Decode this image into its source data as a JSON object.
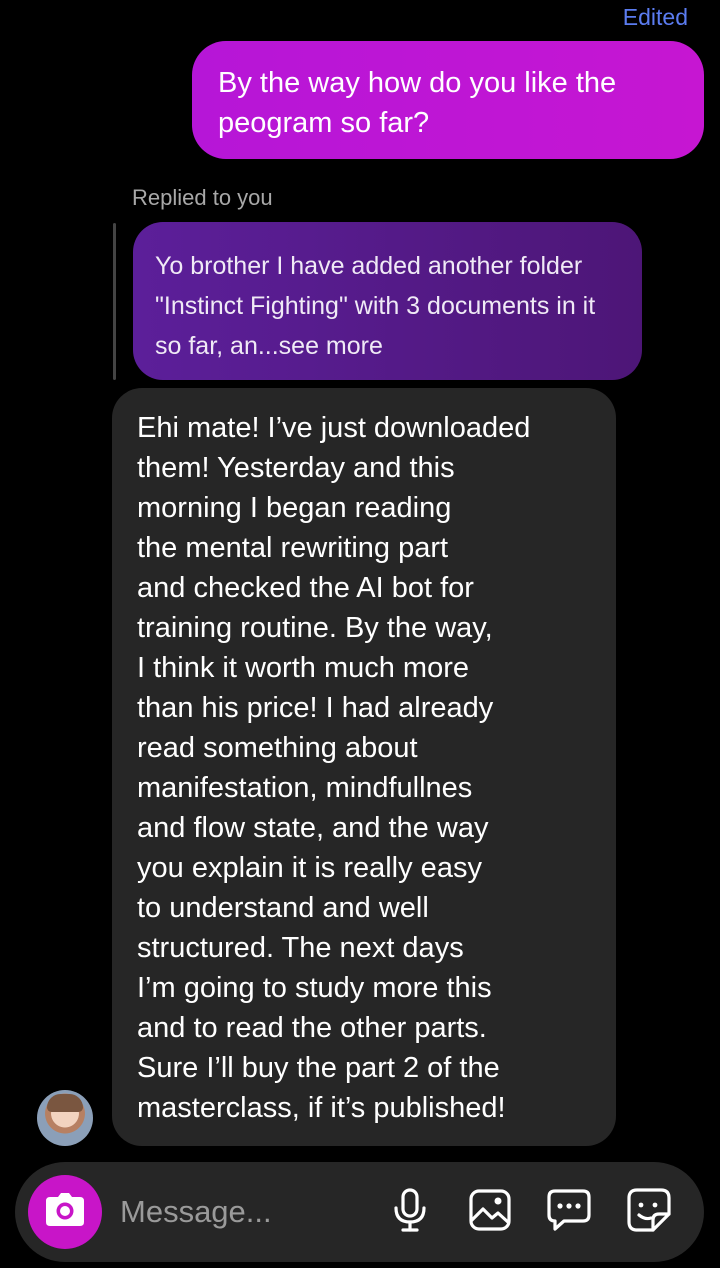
{
  "thread": {
    "edited_label": "Edited",
    "sent_message": "By the way how do you like the peogram so far?",
    "replied_label": "Replied to you",
    "quoted_message": "Yo brother I have added another folder \"Instinct Fighting\" with 3 documents in it so far, an...see more",
    "received_message": "Ehi mate! I’ve just downloaded\nthem! Yesterday and this\nmorning I began reading\nthe mental rewriting part\nand checked the AI bot for\ntraining routine. By the way,\nI think it worth much more\nthan his price! I had already\nread something about\nmanifestation, mindfullnes\nand flow state, and the way\nyou explain it is really easy\nto understand and well\nstructured. The next days\nI’m going to study more this\nand to read the other parts.\nSure I’ll buy the part 2 of the\nmasterclass, if it’s published!"
  },
  "composer": {
    "placeholder": "Message...",
    "icons": [
      "camera-icon",
      "microphone-icon",
      "gallery-icon",
      "chat-bubble-icon",
      "sticker-icon"
    ]
  },
  "colors": {
    "sent_bubble": "#c016d4",
    "quoted_bubble": "#561b8c",
    "received_bubble": "#262626",
    "accent_blue": "#5b7cf0"
  }
}
